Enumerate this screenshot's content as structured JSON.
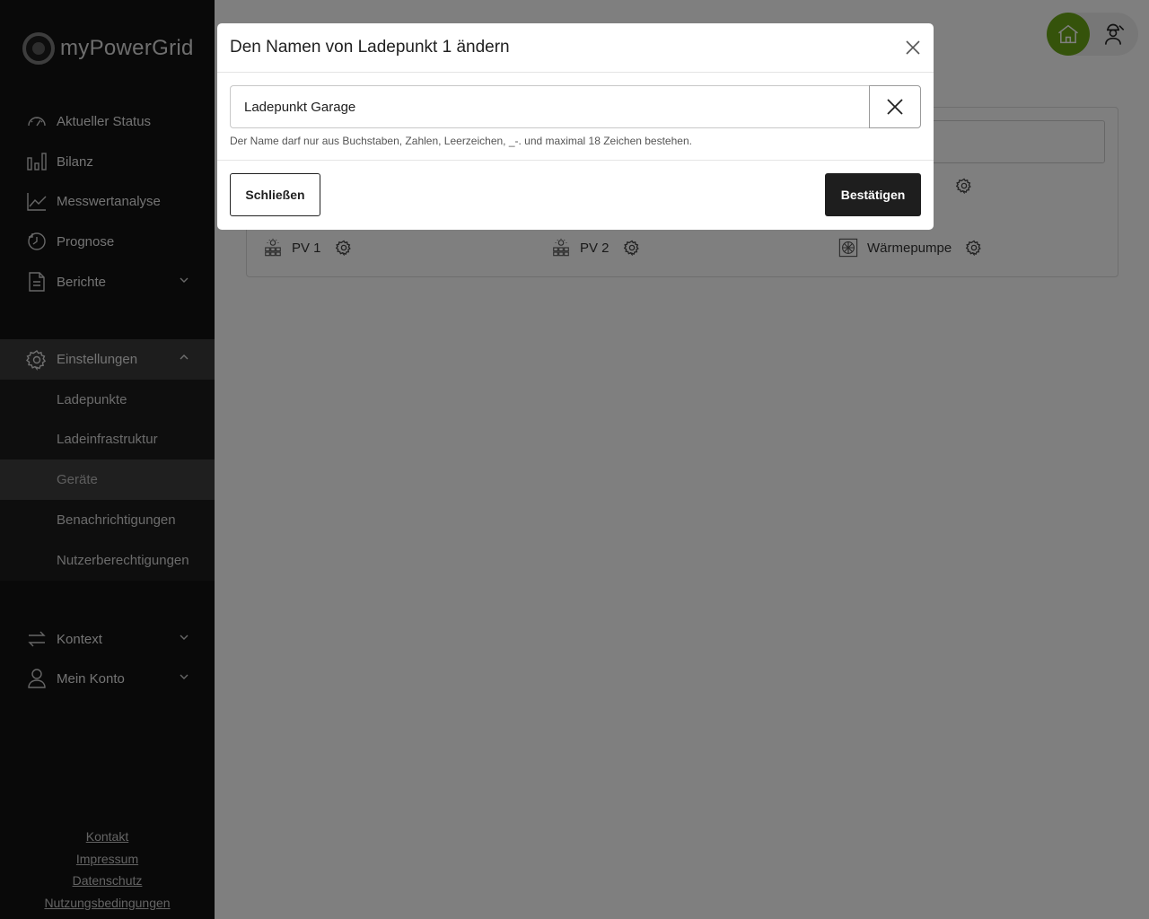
{
  "app": {
    "logo_text": "myPowerGrid"
  },
  "sidebar": {
    "items": [
      {
        "label": "Aktueller Status",
        "icon": "gauge-icon"
      },
      {
        "label": "Bilanz",
        "icon": "bar-chart-icon"
      },
      {
        "label": "Messwertanalyse",
        "icon": "line-chart-icon"
      },
      {
        "label": "Prognose",
        "icon": "forecast-icon"
      },
      {
        "label": "Berichte",
        "icon": "document-icon"
      },
      {
        "label": "Einstellungen",
        "icon": "gear-icon"
      },
      {
        "label": "Kontext",
        "icon": "swap-arrows-icon"
      },
      {
        "label": "Mein Konto",
        "icon": "user-icon"
      }
    ],
    "settings_sub": [
      {
        "label": "Ladepunkte"
      },
      {
        "label": "Ladeinfrastruktur"
      },
      {
        "label": "Geräte"
      },
      {
        "label": "Benachrichtigungen"
      },
      {
        "label": "Nutzerberechtigungen"
      }
    ],
    "selected_sub": "Geräte",
    "footer": {
      "kontakt": "Kontakt",
      "impressum": "Impressum",
      "datenschutz": "Datenschutz",
      "nutzungsbedingungen": "Nutzungsbedingungen"
    }
  },
  "devices": [
    {
      "label": "PV 1",
      "icon": "solar-panel-icon"
    },
    {
      "label": "PV 2",
      "icon": "solar-panel-icon"
    },
    {
      "label": "Wärmepumpe",
      "icon": "heat-pump-icon"
    }
  ],
  "modal": {
    "title": "Den Namen von Ladepunkt 1 ändern",
    "input_value": "Ladepunkt Garage",
    "hint": "Der Name darf nur aus Buchstaben, Zahlen, Leerzeichen, _-. und maximal 18 Zeichen bestehen.",
    "close_label": "Schließen",
    "confirm_label": "Bestätigen"
  },
  "colors": {
    "sidebar_bg": "#121212",
    "accent_green": "#6aa617",
    "confirm_bg": "#1e1e1e"
  }
}
